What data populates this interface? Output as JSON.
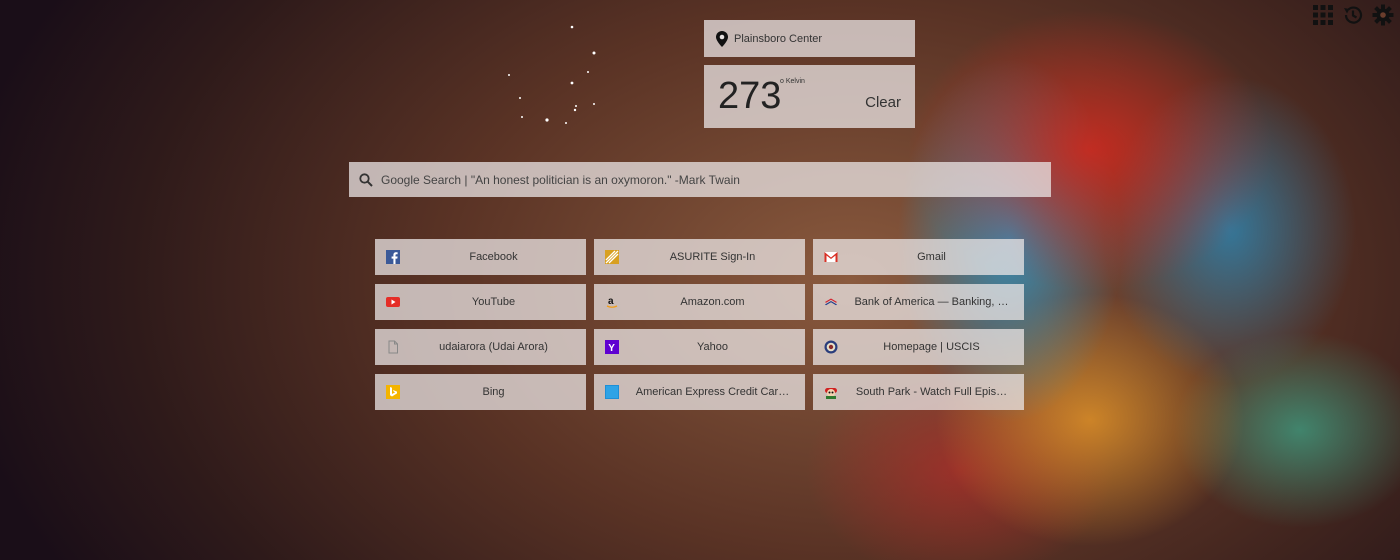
{
  "weather": {
    "location": "Plainsboro Center",
    "temperature": "273",
    "unit": "o Kelvin",
    "condition": "Clear",
    "icon": "moon-stars-icon"
  },
  "search": {
    "placeholder": "Google Search | \"An honest politician is an oxymoron.\" -Mark Twain"
  },
  "toolbar": {
    "icons": [
      "apps-grid-icon",
      "history-icon",
      "settings-gear-icon"
    ]
  },
  "tiles": [
    {
      "label": "Facebook",
      "icon": "facebook-icon"
    },
    {
      "label": "ASURITE Sign-In",
      "icon": "asurite-icon"
    },
    {
      "label": "Gmail",
      "icon": "gmail-icon"
    },
    {
      "label": "YouTube",
      "icon": "youtube-icon"
    },
    {
      "label": "Amazon.com",
      "icon": "amazon-icon"
    },
    {
      "label": "Bank of America — Banking, …",
      "icon": "bank-of-america-icon"
    },
    {
      "label": "udaiarora (Udai Arora)",
      "icon": "page-icon"
    },
    {
      "label": "Yahoo",
      "icon": "yahoo-icon"
    },
    {
      "label": "Homepage | USCIS",
      "icon": "uscis-icon"
    },
    {
      "label": "Bing",
      "icon": "bing-icon"
    },
    {
      "label": "American Express Credit Car…",
      "icon": "amex-icon"
    },
    {
      "label": "South Park - Watch Full Epis…",
      "icon": "south-park-icon"
    }
  ]
}
